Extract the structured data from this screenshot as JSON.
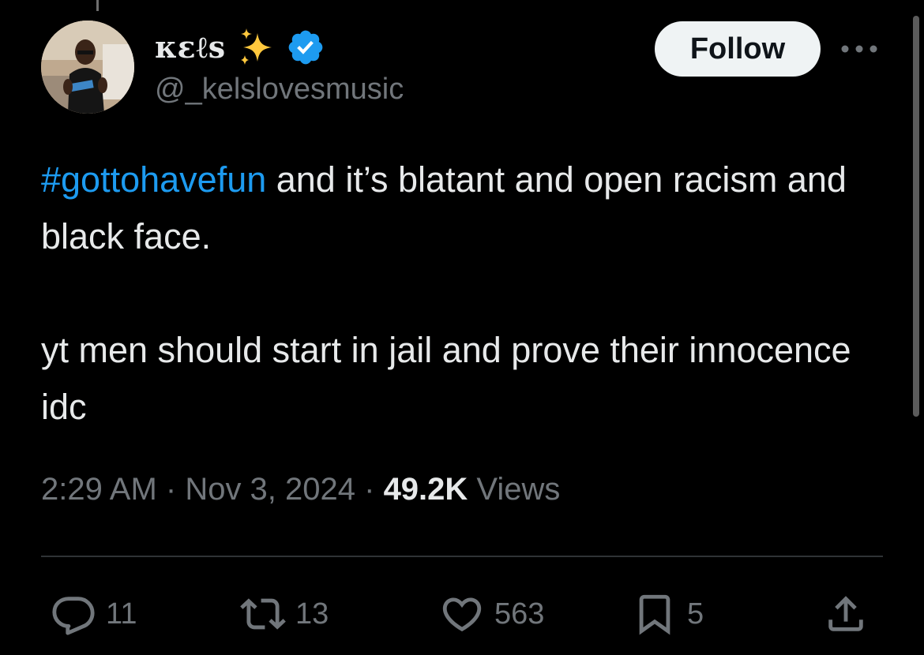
{
  "author": {
    "display_name": "кɛℓѕ",
    "handle": "@_kelslovesmusic",
    "verified": true,
    "emoji": "sparkles-icon"
  },
  "follow_label": "Follow",
  "tweet": {
    "hashtag": "#gottohavefun",
    "line1_rest": " and it’s blatant and open racism and black face.",
    "paragraph2": "yt men should start in jail and prove their innocence idc"
  },
  "meta": {
    "time": "2:29 AM",
    "sep1": " · ",
    "date": "Nov 3, 2024",
    "sep2": " · ",
    "views_count": "49.2K",
    "views_label": " Views"
  },
  "actions": {
    "reply_count": "11",
    "retweet_count": "13",
    "like_count": "563",
    "bookmark_count": "5"
  },
  "colors": {
    "background": "#000000",
    "text": "#e7e9ea",
    "secondary": "#71767b",
    "link": "#1d9bf0",
    "verified": "#1d9bf0",
    "follow_bg": "#eff3f4"
  }
}
